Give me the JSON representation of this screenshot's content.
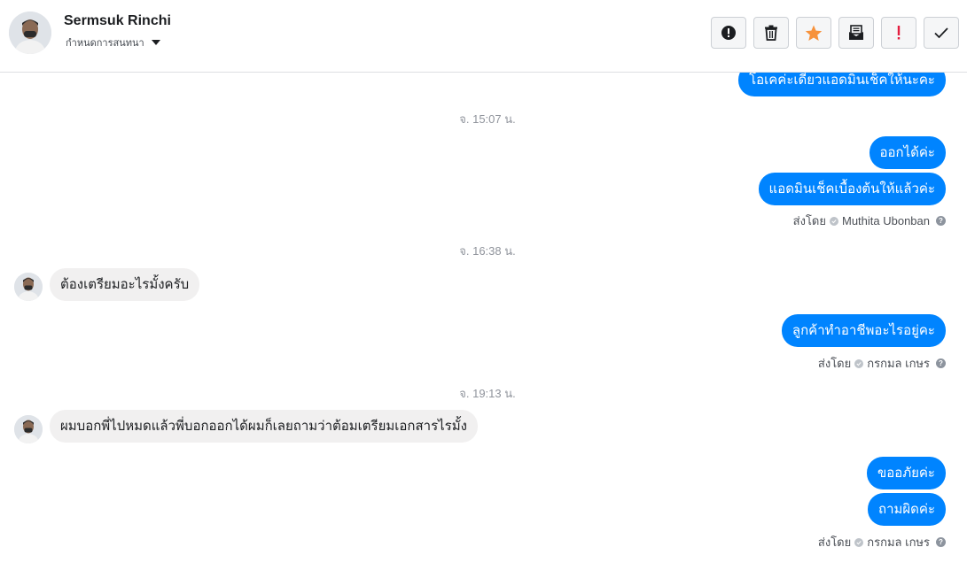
{
  "header": {
    "contact_name": "Sermsuk Rinchi",
    "assign_label": "กำหนดการสนทนา"
  },
  "toolbar": {
    "buttons": [
      {
        "icon": "alert-circle-icon",
        "name": "report-button"
      },
      {
        "icon": "trash-icon",
        "name": "delete-button"
      },
      {
        "icon": "star-icon",
        "name": "star-button",
        "color": "#f7923b"
      },
      {
        "icon": "mail-icon",
        "name": "mark-unread-button"
      },
      {
        "icon": "exclamation-icon",
        "name": "mark-spam-button",
        "color": "#e41e3f"
      },
      {
        "icon": "checkmark-icon",
        "name": "mark-done-button"
      }
    ]
  },
  "colors": {
    "outgoing_bubble": "#0084ff",
    "incoming_bubble": "#f1f0f0",
    "timestamp": "#90949c"
  },
  "messages": {
    "out_1": "โอเคค่ะเดี๋ยวแอดมินเช็คให้นะคะ",
    "ts_1": "จ. 15:07 น.",
    "out_2": "ออกได้ค่ะ",
    "out_3": "แอดมินเช็คเบื้องต้นให้แล้วค่ะ",
    "sent_by_1_prefix": "ส่งโดย",
    "sent_by_1_name": "Muthita Ubonban",
    "ts_2": "จ. 16:38 น.",
    "in_1": "ต้องเตรียมอะไรมั้งครับ",
    "out_4": "ลูกค้าทำอาชีพอะไรอยู่คะ",
    "sent_by_2_prefix": "ส่งโดย",
    "sent_by_2_name": "กรกมล เกษร",
    "ts_3": "จ. 19:13 น.",
    "in_2": "ผมบอกพี่ไปหมดแล้วพี่บอกออกได้ผมก็เลยถามว่าต้อมเตรียมเอกสารไรมั้ง",
    "out_5": "ขออภัยค่ะ",
    "out_6": "ถามผิดค่ะ",
    "sent_by_3_prefix": "ส่งโดย",
    "sent_by_3_name": "กรกมล เกษร"
  }
}
